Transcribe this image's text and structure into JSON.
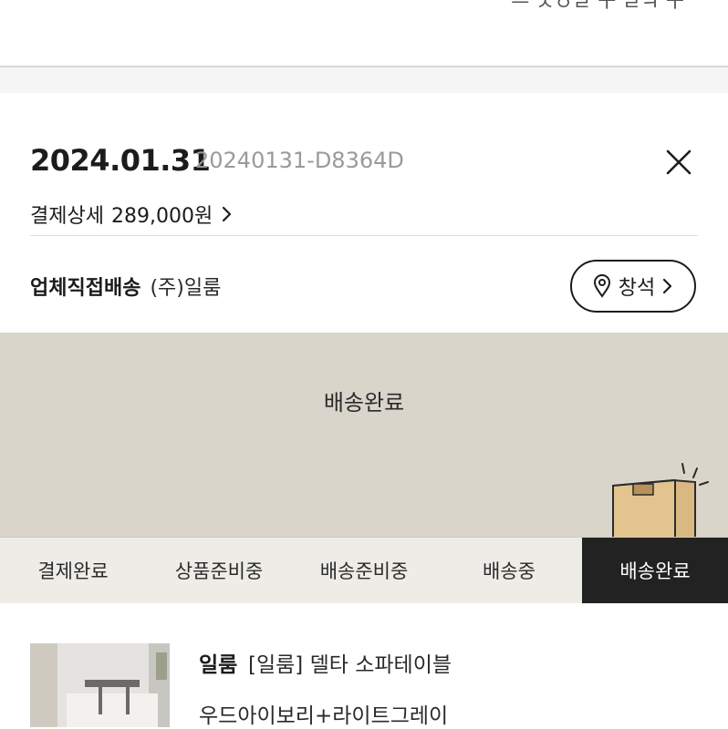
{
  "top": {
    "partial_text": "ㅡ ㅅㅇㄹ ㅜ ㄹㅋ ㅜ"
  },
  "order": {
    "date": "2024.01.31",
    "number": "20240131-D8364D",
    "payment_label": "결제상세",
    "payment_amount": "289,000원"
  },
  "delivery": {
    "type": "업체직접배송",
    "seller": "(주)일룸",
    "location_button": "창석"
  },
  "status": {
    "current": "배송완료",
    "steps": [
      "결제완료",
      "상품준비중",
      "배송준비중",
      "배송중",
      "배송완료"
    ],
    "active_index": 4
  },
  "product": {
    "brand": "일룸",
    "name": "[일룸] 델타 소파테이블",
    "option": "우드아이보리+라이트그레이"
  }
}
